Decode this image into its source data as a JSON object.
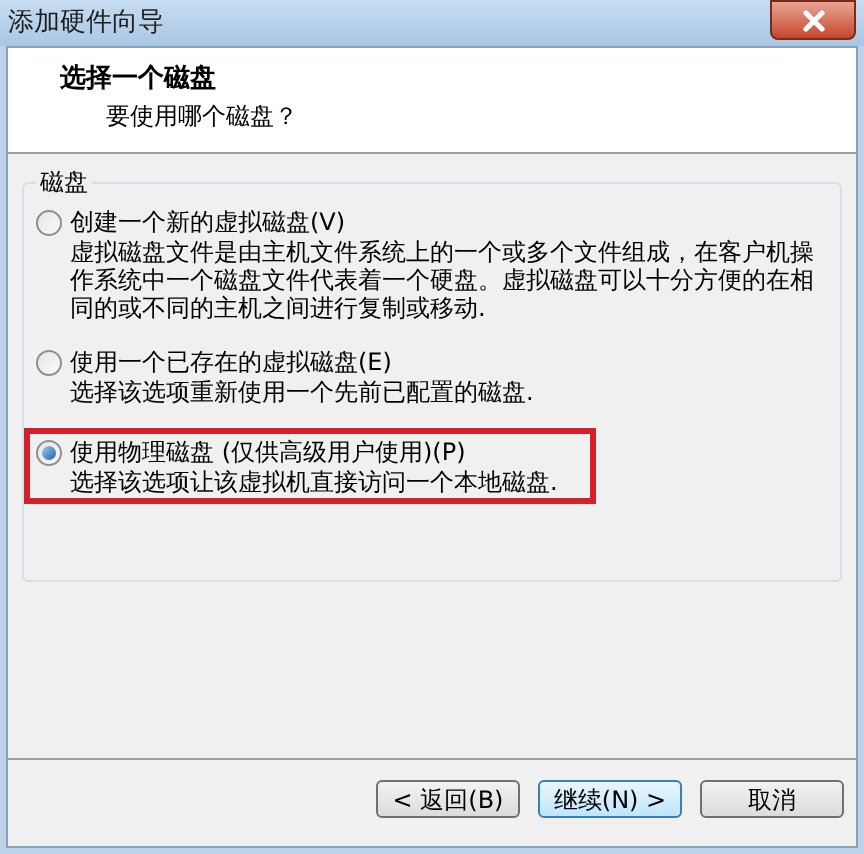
{
  "window": {
    "title": "添加硬件向导"
  },
  "header": {
    "title": "选择一个磁盘",
    "subtitle": "要使用哪个磁盘？"
  },
  "group": {
    "label": "磁盘",
    "options": [
      {
        "label": "创建一个新的虚拟磁盘(V)",
        "description": "虚拟磁盘文件是由主机文件系统上的一个或多个文件组成，在客户机操作系统中一个磁盘文件代表着一个硬盘。虚拟磁盘可以十分方便的在相同的或不同的主机之间进行复制或移动.",
        "selected": false,
        "highlighted": false
      },
      {
        "label": "使用一个已存在的虚拟磁盘(E)",
        "description": "选择该选项重新使用一个先前已配置的磁盘.",
        "selected": false,
        "highlighted": false
      },
      {
        "label": "使用物理磁盘 (仅供高级用户使用)(P)",
        "description": "选择该选项让该虚拟机直接访问一个本地磁盘.",
        "selected": true,
        "highlighted": true
      }
    ]
  },
  "buttons": [
    {
      "label": "< 返回(B)",
      "focused": false
    },
    {
      "label": "继续(N) >",
      "focused": true
    },
    {
      "label": "取消",
      "focused": false
    }
  ]
}
